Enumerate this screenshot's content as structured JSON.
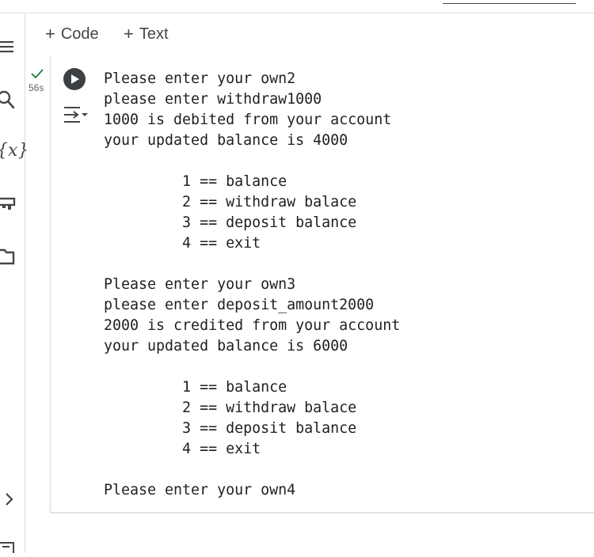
{
  "toolbar": {
    "code_label": "Code",
    "text_label": "Text",
    "plus_symbol": "+"
  },
  "sidebar": {
    "icons": [
      "menu-icon",
      "search-icon",
      "variables-icon",
      "secrets-key-icon",
      "folder-icon"
    ],
    "variables_glyph": "{x}",
    "expand_icon": "chevron-right-icon"
  },
  "cell": {
    "status_icon": "checkmark-icon",
    "execution_time": "56s",
    "run_icon": "play-icon",
    "output_toggle_icon": "output-toggle-icon",
    "output_lines": [
      "Please enter your own2",
      "please enter withdraw1000",
      "1000 is debited from your account",
      "your updated balance is 4000",
      "",
      "         1 == balance",
      "         2 == withdraw balace",
      "         3 == deposit balance",
      "         4 == exit",
      "",
      "Please enter your own3",
      "please enter deposit_amount2000",
      "2000 is credited from your account",
      "your updated balance is 6000",
      "",
      "         1 == balance",
      "         2 == withdraw balace",
      "         3 == deposit balance",
      "         4 == exit",
      "",
      "Please enter your own4"
    ]
  },
  "colors": {
    "success_green": "#188038",
    "run_button": "#3c4043",
    "text_dark": "#1f1f1f",
    "icon_gray": "#444746"
  }
}
